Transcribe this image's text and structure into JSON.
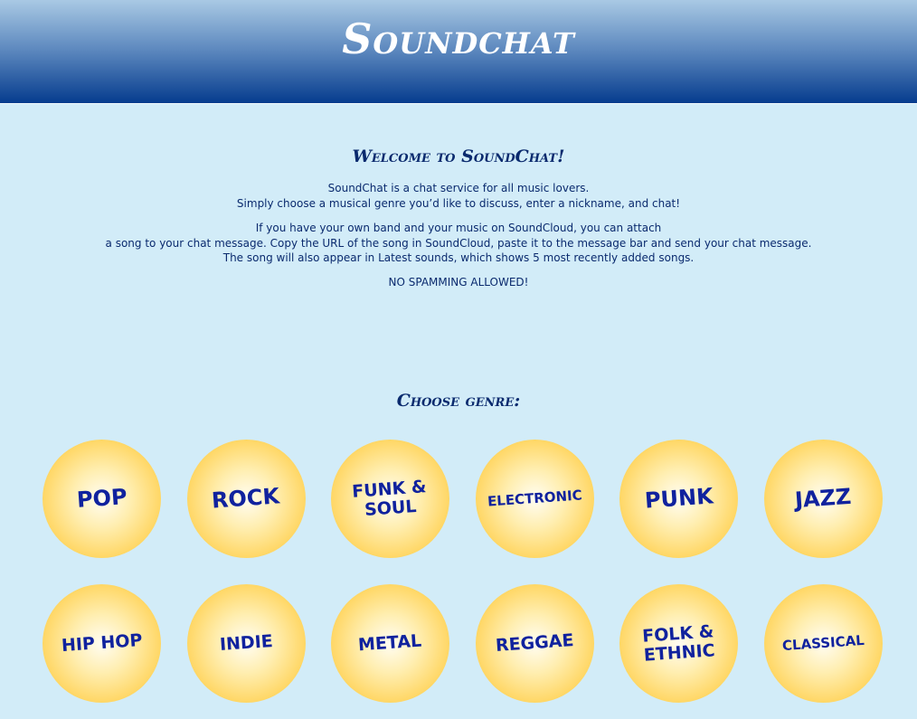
{
  "header": {
    "title": "Soundchat"
  },
  "intro": {
    "heading": "Welcome to SoundChat!",
    "para1": {
      "line1": "SoundChat is a chat service for all music lovers.",
      "line2": "Simply choose a musical genre you’d like to discuss, enter a nickname, and chat!"
    },
    "para2": {
      "line1": "If you have your own band and your music on SoundCloud, you can attach",
      "line2": "a song to your chat message. Copy the URL of the song in SoundCloud, paste it to the message bar and send your chat message.",
      "line3": "The song will also appear in Latest sounds, which shows 5 most recently added songs."
    },
    "warning": "NO SPAMMING ALLOWED!"
  },
  "genres": {
    "heading": "Choose genre:",
    "items": [
      {
        "label": "POP"
      },
      {
        "label": "ROCK"
      },
      {
        "label": "FUNK &\nSOUL"
      },
      {
        "label": "ELECTRONIC"
      },
      {
        "label": "PUNK"
      },
      {
        "label": "JAZZ"
      },
      {
        "label": "HIP HOP"
      },
      {
        "label": "INDIE"
      },
      {
        "label": "METAL"
      },
      {
        "label": "REGGAE"
      },
      {
        "label": "FOLK &\nETHNIC"
      },
      {
        "label": "CLASSICAL"
      }
    ]
  },
  "colors": {
    "background": "#d2ecf8",
    "header_top": "#a9c9e4",
    "header_bottom": "#063c8e",
    "text": "#0a2a6e",
    "genre_label": "#10229e",
    "genre_circle": "#fbc23c"
  }
}
